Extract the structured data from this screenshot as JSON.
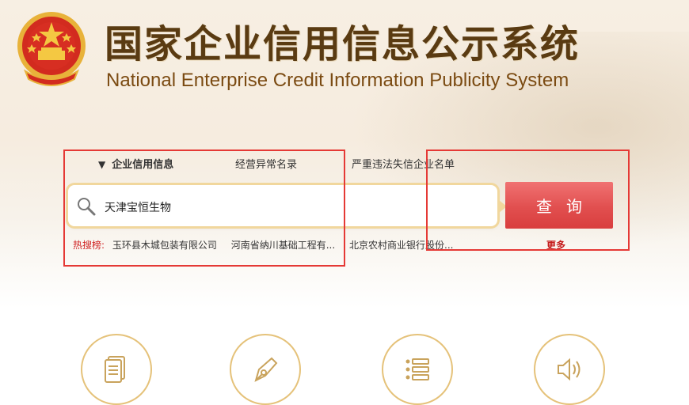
{
  "header": {
    "title_cn": "国家企业信用信息公示系统",
    "title_en": "National Enterprise Credit Information Publicity System",
    "emblem_icon": "national-emblem-icon"
  },
  "tabs": [
    {
      "label": "企业信用信息",
      "active": true
    },
    {
      "label": "经营异常名录",
      "active": false
    },
    {
      "label": "严重违法失信企业名单",
      "active": false
    }
  ],
  "search": {
    "value": "天津宝恒生物",
    "button_label": "查询"
  },
  "hot_search": {
    "label": "热搜榜:",
    "items": [
      "玉环县木城包装有限公司",
      "河南省纳川基础工程有...",
      "北京农村商业银行股份..."
    ],
    "more_label": "更多"
  },
  "feature_icons": [
    "document-icon",
    "pen-icon",
    "list-icon",
    "speaker-icon"
  ],
  "colors": {
    "brand_brown": "#5a3b12",
    "search_button": "#e14f4f",
    "highlight_box": "#e53935",
    "icon_ring": "#e5c27a"
  }
}
